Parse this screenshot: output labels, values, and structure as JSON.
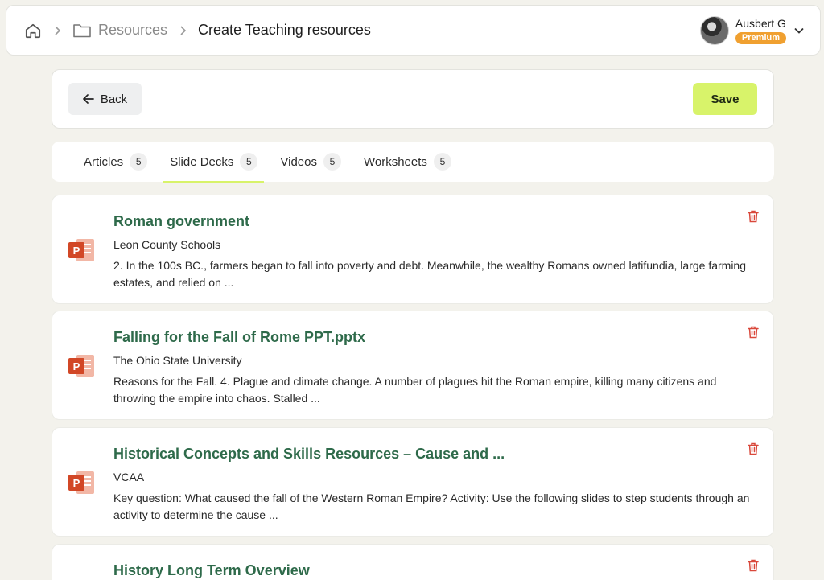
{
  "breadcrumb": {
    "home_icon": "home-icon",
    "folder_icon": "folder-icon",
    "resources": "Resources",
    "current": "Create Teaching resources"
  },
  "user": {
    "name": "Ausbert G",
    "badge": "Premium"
  },
  "actions": {
    "back_label": "Back",
    "save_label": "Save"
  },
  "tabs": [
    {
      "label": "Articles",
      "count": "5"
    },
    {
      "label": "Slide Decks",
      "count": "5",
      "active": true
    },
    {
      "label": "Videos",
      "count": "5"
    },
    {
      "label": "Worksheets",
      "count": "5"
    }
  ],
  "resources": [
    {
      "title": "Roman government",
      "source": "Leon County Schools",
      "description": "2. In the 100s BC., farmers began to fall into poverty and debt. Meanwhile, the wealthy Romans owned latifundia, large farming estates, and relied on ..."
    },
    {
      "title": "Falling for the Fall of Rome PPT.pptx",
      "source": "The Ohio State University",
      "description": "Reasons for the Fall. 4. Plague and climate change. A number of plagues hit the Roman empire, killing many citizens and throwing the empire into chaos. Stalled ..."
    },
    {
      "title": "Historical Concepts and Skills Resources – Cause and ...",
      "source": "VCAA",
      "description": "Key question: What caused the fall of the Western Roman Empire? Activity: Use the following slides to step students through an activity to determine the cause ..."
    },
    {
      "title": "History Long Term Overview",
      "source": "",
      "description": ""
    }
  ],
  "colors": {
    "accent": "#d8f36a",
    "title_green": "#2e6a4a",
    "premium_orange": "#f0a030",
    "ppt_red": "#d24726",
    "trash_red": "#d9483b"
  }
}
